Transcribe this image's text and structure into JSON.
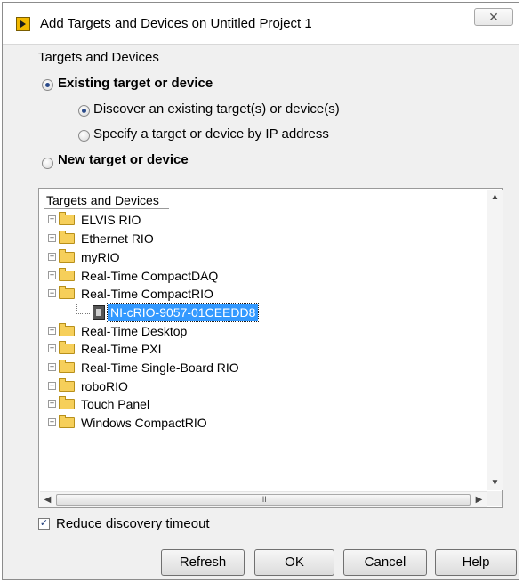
{
  "window": {
    "title": "Add Targets and Devices on Untitled Project 1",
    "close_label": "✕"
  },
  "options": {
    "group_label": "Targets and Devices",
    "existing_label": "Existing target or device",
    "existing_selected": true,
    "discover_label": "Discover an existing target(s) or device(s)",
    "discover_selected": true,
    "specify_ip_label": "Specify a target or device by IP address",
    "specify_ip_selected": false,
    "new_label": "New target or device",
    "new_selected": false
  },
  "tree": {
    "header": "Targets and Devices",
    "items": [
      {
        "label": "ELVIS RIO",
        "expanded": false
      },
      {
        "label": "Ethernet RIO",
        "expanded": false
      },
      {
        "label": "myRIO",
        "expanded": false
      },
      {
        "label": "Real-Time CompactDAQ",
        "expanded": false
      },
      {
        "label": "Real-Time CompactRIO",
        "expanded": true
      },
      {
        "label": "Real-Time Desktop",
        "expanded": false
      },
      {
        "label": "Real-Time PXI",
        "expanded": false
      },
      {
        "label": "Real-Time Single-Board RIO",
        "expanded": false
      },
      {
        "label": "roboRIO",
        "expanded": false
      },
      {
        "label": "Touch Panel",
        "expanded": false
      },
      {
        "label": "Windows CompactRIO",
        "expanded": false
      }
    ],
    "selected_device": "NI-cRIO-9057-01CEEDD8",
    "hscroll_grip": "III"
  },
  "reduce_timeout": {
    "label": "Reduce discovery timeout",
    "checked": true
  },
  "buttons": {
    "refresh": "Refresh",
    "ok": "OK",
    "cancel": "Cancel",
    "help": "Help"
  },
  "icons": {
    "app": "labview-icon",
    "folder": "folder-icon",
    "device": "crio-device-icon"
  }
}
